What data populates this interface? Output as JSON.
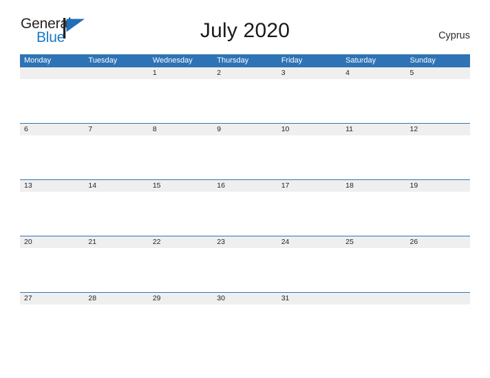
{
  "brand": {
    "name_part1": "General",
    "name_part2": "Blue",
    "flag_icon": "blue-flag-icon",
    "colors": {
      "text_dark": "#231f20",
      "blue": "#1679c6"
    }
  },
  "header": {
    "title": "July 2020",
    "region": "Cyprus"
  },
  "calendar": {
    "header_bg": "#2e73b5",
    "date_band_bg": "#efefef",
    "weekdays": [
      "Monday",
      "Tuesday",
      "Wednesday",
      "Thursday",
      "Friday",
      "Saturday",
      "Sunday"
    ],
    "weeks": [
      [
        "",
        "",
        "1",
        "2",
        "3",
        "4",
        "5"
      ],
      [
        "6",
        "7",
        "8",
        "9",
        "10",
        "11",
        "12"
      ],
      [
        "13",
        "14",
        "15",
        "16",
        "17",
        "18",
        "19"
      ],
      [
        "20",
        "21",
        "22",
        "23",
        "24",
        "25",
        "26"
      ],
      [
        "27",
        "28",
        "29",
        "30",
        "31",
        "",
        ""
      ]
    ]
  }
}
